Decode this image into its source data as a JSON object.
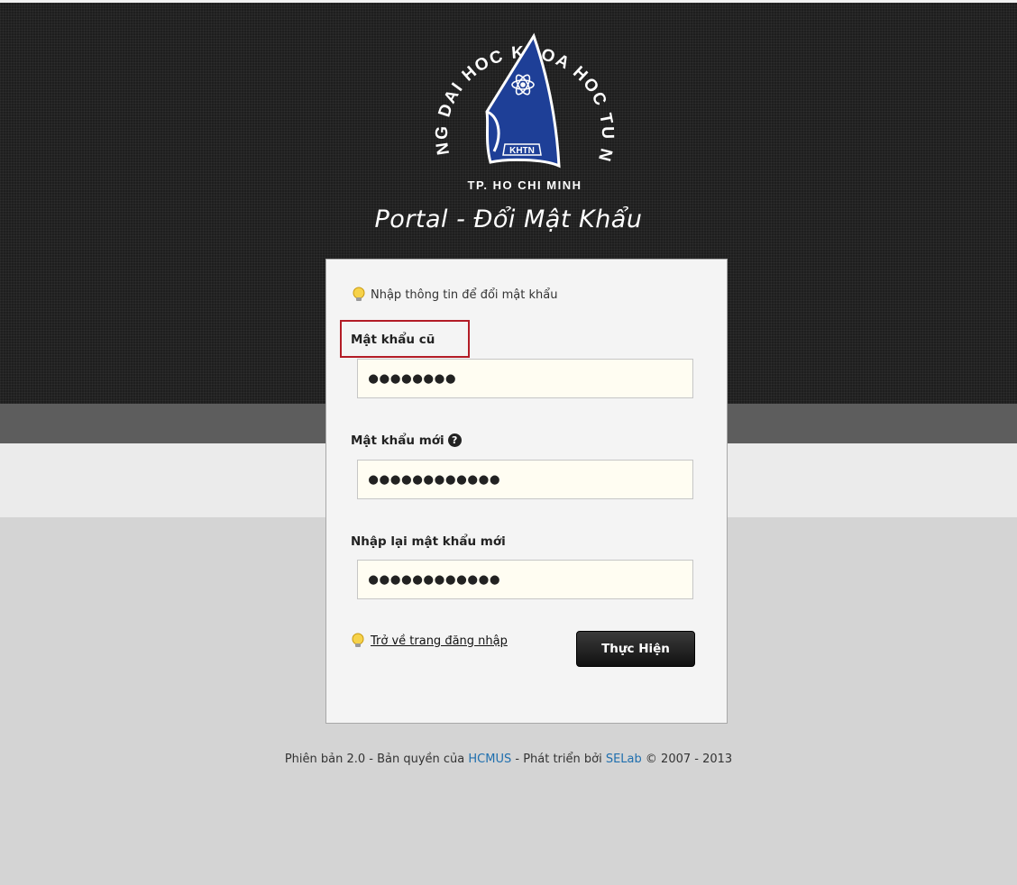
{
  "logo": {
    "arc_text": "TRUONG DAI HOC KHOA HOC TU NHIEN",
    "bottom_text": "TP. HO CHI MINH",
    "badge_text": "KHTN"
  },
  "portal_title": "Portal - Đổi Mật Khẩu",
  "form": {
    "hint": "Nhập thông tin để đổi mật khẩu",
    "old_password_label": "Mật khẩu cũ",
    "old_password_value": "●●●●●●●●",
    "new_password_label": "Mật khẩu mới",
    "new_password_value": "●●●●●●●●●●●●",
    "confirm_password_label": "Nhập lại mật khẩu mới",
    "confirm_password_value": "●●●●●●●●●●●●",
    "back_link": "Trở về trang đăng nhập",
    "submit_label": "Thực Hiện",
    "help_symbol": "?"
  },
  "footer": {
    "prefix": "Phiên bản 2.0 - Bản quyền của ",
    "hcmus": "HCMUS",
    "middle": " - Phát triển bởi ",
    "selab": "SELab",
    "suffix": " © 2007 - 2013"
  },
  "colors": {
    "highlight_border": "#b31c26",
    "logo_blue": "#1e3f97",
    "link": "#1f6fae"
  }
}
